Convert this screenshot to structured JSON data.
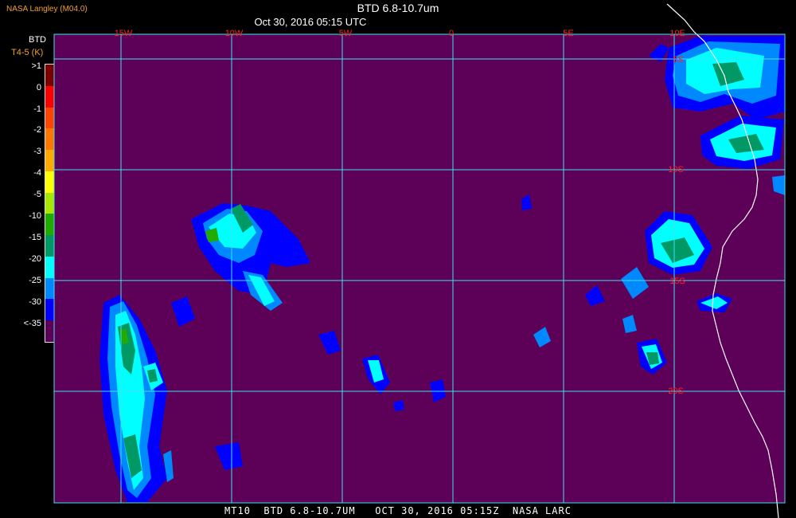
{
  "header": {
    "credit": "NASA Langley (M04.0)",
    "title": "BTD 6.8-10.7um",
    "subtitle": "Oct 30, 2016 05:15 UTC"
  },
  "legend": {
    "title_line1": "BTD",
    "title_line2": "T4-5 (K)",
    "labels": [
      ">1",
      "0",
      "-1",
      "-2",
      "-3",
      "-4",
      "-5",
      "-10",
      "-15",
      "-20",
      "-25",
      "-30",
      "<-35"
    ],
    "colors": [
      "#7a0000",
      "#ff0000",
      "#ff4400",
      "#ff7700",
      "#ffaa00",
      "#ffff00",
      "#a8e800",
      "#22aa00",
      "#009966",
      "#00ffff",
      "#0088ff",
      "#0000ff",
      "#5c0058"
    ]
  },
  "map": {
    "background_color": "#5c0058",
    "grid_color": "#40e0f0",
    "longitude_labels": [
      "15W",
      "10W",
      "5W",
      "0",
      "5E",
      "10E"
    ],
    "latitude_labels": [
      "5S",
      "10S",
      "15S",
      "20S"
    ],
    "label_color": "#ff2020",
    "coast_color": "#ffffff"
  },
  "footer": {
    "text": "MT10  BTD 6.8-10.7UM   OCT 30, 2016 05:15Z  NASA LARC"
  }
}
